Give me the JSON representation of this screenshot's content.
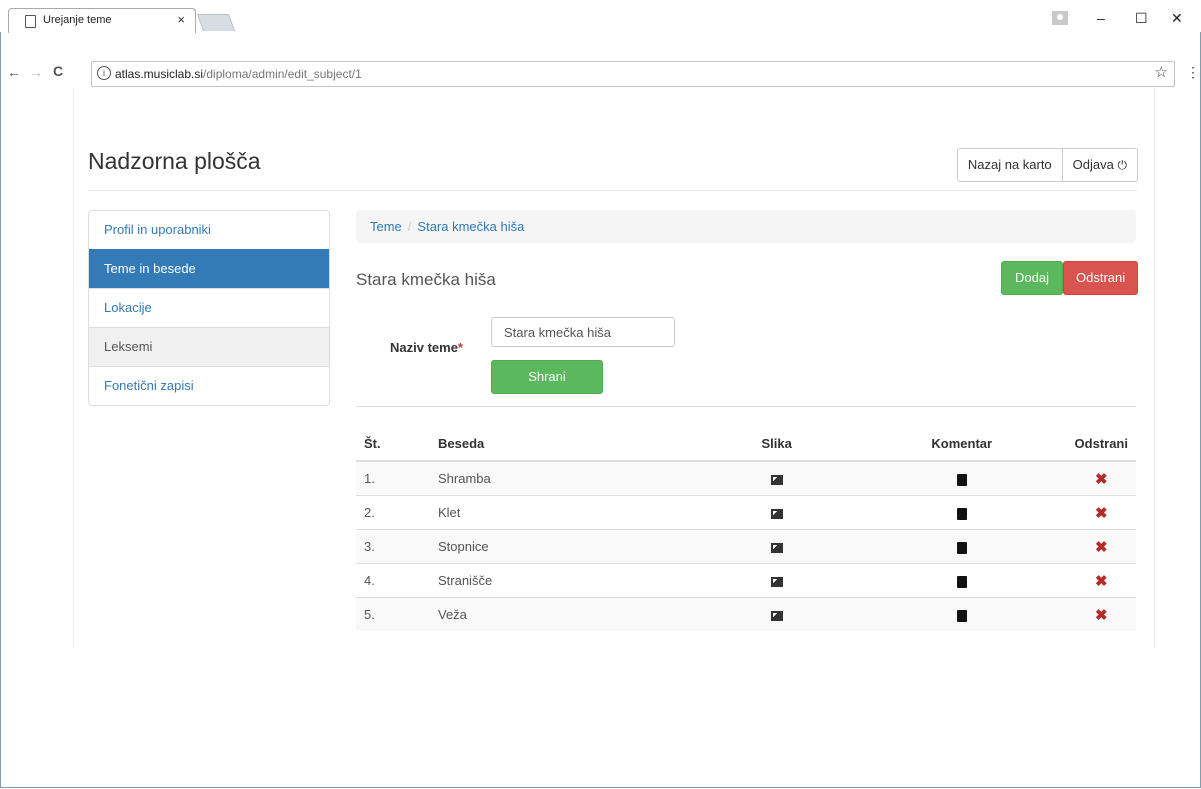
{
  "browser": {
    "tab_title": "Urejanje teme",
    "url_host": "atlas.musiclab.si",
    "url_path": "/diploma/admin/edit_subject/1"
  },
  "header": {
    "title": "Nadzorna plošča",
    "back_button": "Nazaj na karto",
    "logout_button": "Odjava"
  },
  "sidebar": {
    "items": [
      {
        "label": "Profil in uporabniki"
      },
      {
        "label": "Teme in besede"
      },
      {
        "label": "Lokacije"
      },
      {
        "label": "Leksemi"
      },
      {
        "label": "Fonetični zapisi"
      }
    ]
  },
  "breadcrumb": {
    "root": "Teme",
    "current": "Stara kmečka hiša"
  },
  "subject": {
    "title": "Stara kmečka hiša",
    "add_button": "Dodaj",
    "delete_button": "Odstrani"
  },
  "form": {
    "label": "Naziv teme",
    "required_mark": "*",
    "value": "Stara kmečka hiša",
    "save_button": "Shrani"
  },
  "table": {
    "headers": [
      "Št.",
      "Beseda",
      "Slika",
      "Komentar",
      "Odstrani"
    ],
    "rows": [
      {
        "num": "1.",
        "word": "Shramba"
      },
      {
        "num": "2.",
        "word": "Klet"
      },
      {
        "num": "3.",
        "word": "Stopnice"
      },
      {
        "num": "4.",
        "word": "Stranišče"
      },
      {
        "num": "5.",
        "word": "Veža"
      }
    ]
  },
  "colors": {
    "primary": "#337ab7",
    "success": "#5cb85c",
    "danger": "#d9534f"
  },
  "icons": [
    "page-icon",
    "close-icon",
    "back-arrow-icon",
    "forward-arrow-icon",
    "reload-icon",
    "info-icon",
    "star-icon",
    "menu-dots-icon",
    "power-icon",
    "image-icon",
    "book-icon",
    "remove-x-icon"
  ]
}
